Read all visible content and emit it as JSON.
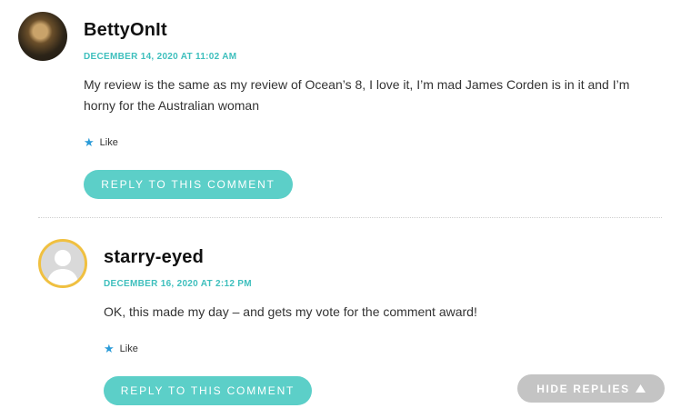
{
  "comments": [
    {
      "author": "BettyOnIt",
      "date": "DECEMBER 14, 2020 AT 11:02 AM",
      "text": "My review is the same as my review of Ocean’s 8, I love it, I’m mad James Corden is in it and I’m horny for the Australian woman",
      "like_label": "Like",
      "reply_label": "REPLY TO THIS COMMENT"
    },
    {
      "author": "starry-eyed",
      "date": "DECEMBER 16, 2020 AT 2:12 PM",
      "text": "OK, this made my day – and gets my vote for the comment award!",
      "like_label": "Like",
      "reply_label": "REPLY TO THIS COMMENT"
    }
  ],
  "hide_replies_label": "HIDE REPLIES",
  "colors": {
    "accent": "#3ebfbd",
    "reply_button": "#5ccfc8",
    "hide_button": "#c4c4c4",
    "like_star": "#2a9bd8"
  },
  "icons": {
    "like": "star-icon",
    "hide": "triangle-up-icon"
  }
}
